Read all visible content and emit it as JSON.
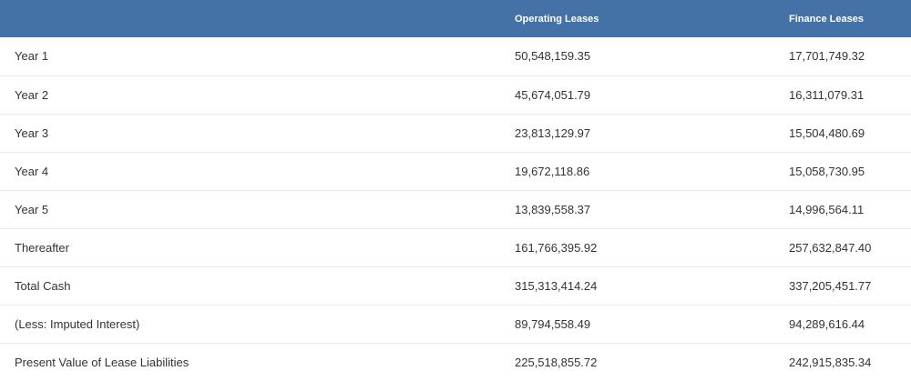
{
  "table": {
    "headers": [
      "",
      "Operating Leases",
      "Finance Leases"
    ],
    "rows": [
      {
        "label": "Year 1",
        "operating": "50,548,159.35",
        "finance": "17,701,749.32"
      },
      {
        "label": "Year 2",
        "operating": "45,674,051.79",
        "finance": "16,311,079.31"
      },
      {
        "label": "Year 3",
        "operating": "23,813,129.97",
        "finance": "15,504,480.69"
      },
      {
        "label": "Year 4",
        "operating": "19,672,118.86",
        "finance": "15,058,730.95"
      },
      {
        "label": "Year 5",
        "operating": "13,839,558.37",
        "finance": "14,996,564.11"
      },
      {
        "label": "Thereafter",
        "operating": "161,766,395.92",
        "finance": "257,632,847.40"
      },
      {
        "label": "Total Cash",
        "operating": "315,313,414.24",
        "finance": "337,205,451.77"
      },
      {
        "label": "(Less: Imputed Interest)",
        "operating": "89,794,558.49",
        "finance": "94,289,616.44"
      },
      {
        "label": "Present Value of Lease Liabilities",
        "operating": "225,518,855.72",
        "finance": "242,915,835.34"
      }
    ]
  },
  "colors": {
    "header_bg": "#4472a6",
    "header_text": "#ffffff",
    "body_text": "#333333",
    "row_divider": "#ebebeb"
  }
}
